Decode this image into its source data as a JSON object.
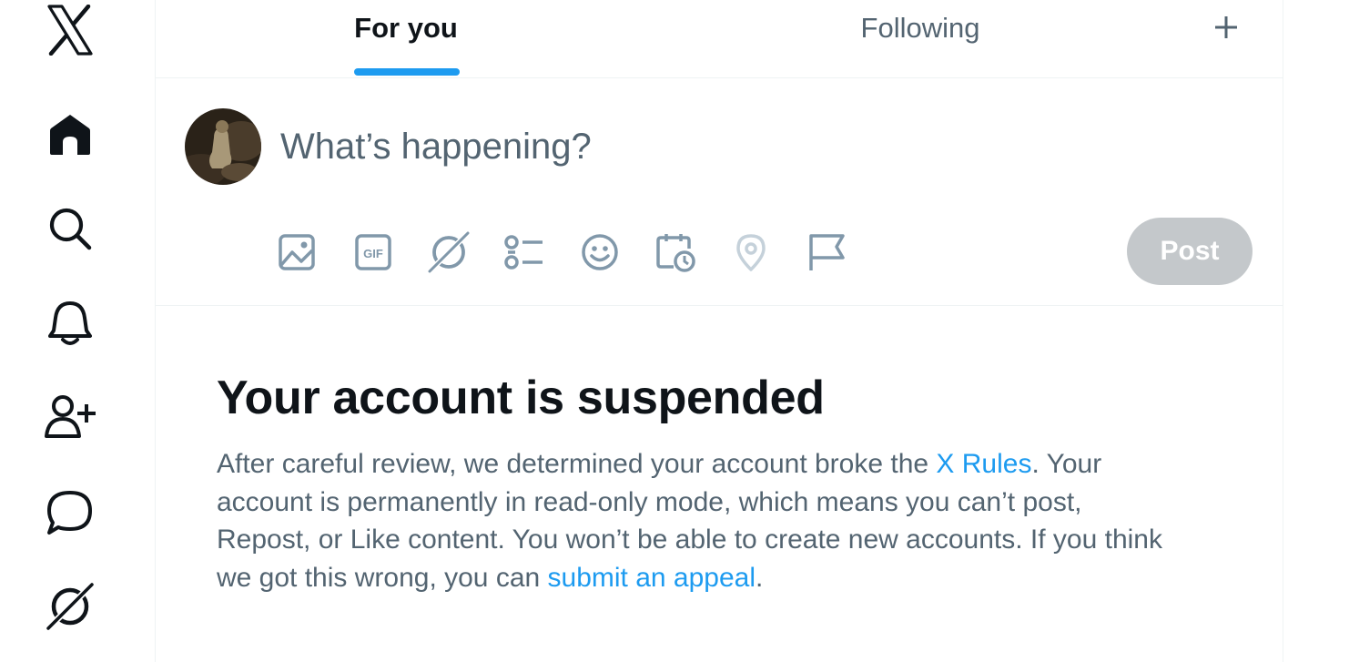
{
  "nav": {
    "items": [
      {
        "name": "x-logo-icon"
      },
      {
        "name": "home-icon"
      },
      {
        "name": "search-icon"
      },
      {
        "name": "notifications-icon"
      },
      {
        "name": "follow-icon"
      },
      {
        "name": "messages-icon"
      },
      {
        "name": "grok-icon"
      }
    ]
  },
  "tabs": {
    "for_you": "For you",
    "following": "Following",
    "add_icon": "plus-icon"
  },
  "composer": {
    "placeholder": "What’s happening?",
    "value": "",
    "post_label": "Post",
    "toolbar_icons": [
      "media-icon",
      "gif-icon",
      "grok-icon",
      "poll-icon",
      "emoji-icon",
      "schedule-icon",
      "location-icon",
      "flag-icon"
    ]
  },
  "notice": {
    "title": "Your account is suspended",
    "body_part1": "After careful review, we determined your account broke the ",
    "rules_link": "X Rules",
    "body_part2": ". Your account is permanently in read-only mode, which means you can’t post, Repost, or Like content. You won’t be able to create new accounts. If you think we got this wrong, you can ",
    "appeal_link": "submit an appeal",
    "body_part3": "."
  },
  "colors": {
    "accent": "#1d9bf0",
    "text_primary": "#0f1419",
    "text_secondary": "#536471",
    "post_disabled": "#c4c8cb"
  }
}
